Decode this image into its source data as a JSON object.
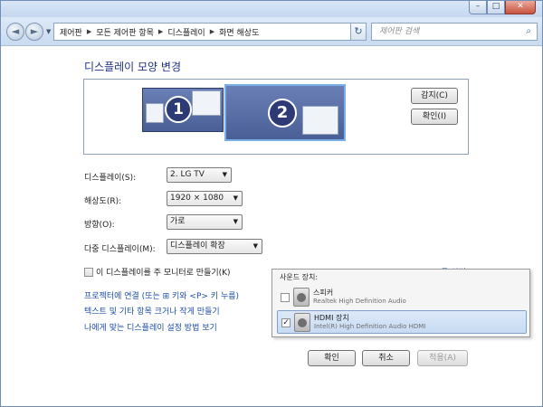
{
  "window": {
    "caption_min": "–",
    "caption_max": "□",
    "caption_close": "✕"
  },
  "nav": {
    "back_glyph": "◄",
    "forward_glyph": "►",
    "history_glyph": "▼",
    "crumbs": [
      "제어판",
      "모든 제어판 항목",
      "디스플레이",
      "화면 해상도"
    ],
    "crumb_sep": "▶",
    "dropdown_glyph": "▼",
    "refresh_glyph": "↻"
  },
  "search": {
    "placeholder": "제어판 검색",
    "icon": "search-icon"
  },
  "main": {
    "title": "디스플레이 모양 변경",
    "monitor_1": "1",
    "monitor_2": "2",
    "detect_label": "감지(C)",
    "identify_label": "확인(I)",
    "display_label": "디스플레이(S):",
    "display_value": "2. LG TV",
    "resolution_label": "해상도(R):",
    "resolution_value": "1920 × 1080",
    "orientation_label": "방향(O):",
    "orientation_value": "가로",
    "multi_label": "다중 디스플레이(M):",
    "multi_value": "디스플레이 확장",
    "combo_arrow": "▼",
    "primary_label": "이 디스플레이를 주 모니터로 만들기(K)",
    "advanced_link": "고급 설정",
    "link_projector": "프로젝터에 연결 (또는 ⊞ 키와 <P> 키 누름)",
    "link_text_size": "텍스트 및 기타 항목 크거나 작게 만들기",
    "link_settings": "나에게 맞는 디스플레이 설정 방법 보기"
  },
  "sound_popup": {
    "title": "사운드 장치:",
    "items": [
      {
        "name": "스피커",
        "desc": "Realtek High Definition Audio",
        "checked": ""
      },
      {
        "name": "HDMI 장치",
        "desc": "Intel(R) High Definition Audio HDMI",
        "checked": "✓"
      }
    ]
  },
  "footer": {
    "ok": "확인",
    "cancel": "취소",
    "apply": "적용(A)"
  }
}
